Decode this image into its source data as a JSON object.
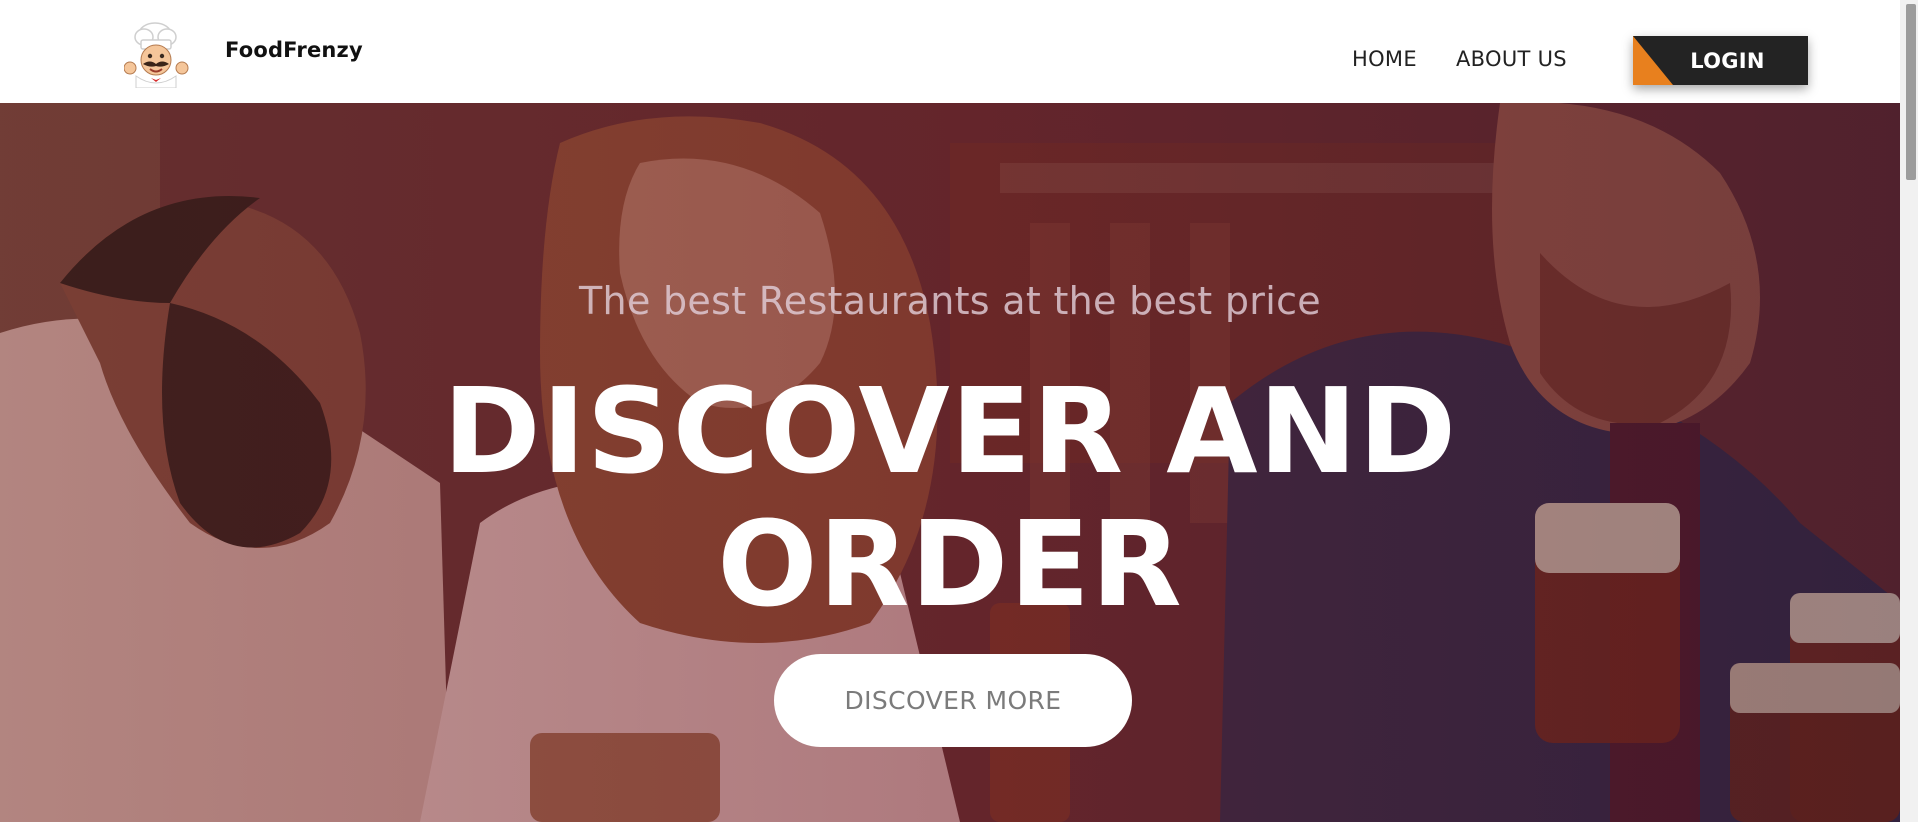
{
  "header": {
    "brand": "FoodFrenzy",
    "logo_icon": "chef-mascot-icon",
    "nav": {
      "home": "HOME",
      "about": "ABOUT US"
    },
    "login_label": "LOGIN"
  },
  "hero": {
    "tagline": "The best Restaurants at the best price",
    "headline_line1": "DISCOVER AND",
    "headline_line2": "ORDER",
    "cta_label": "DISCOVER MORE",
    "background": "photo-friends-dining-with-beer"
  },
  "colors": {
    "accent": "#e8801e",
    "login_bg": "#232323",
    "hero_overlay": "#6b2030",
    "cta_text": "#7b7b7b"
  }
}
